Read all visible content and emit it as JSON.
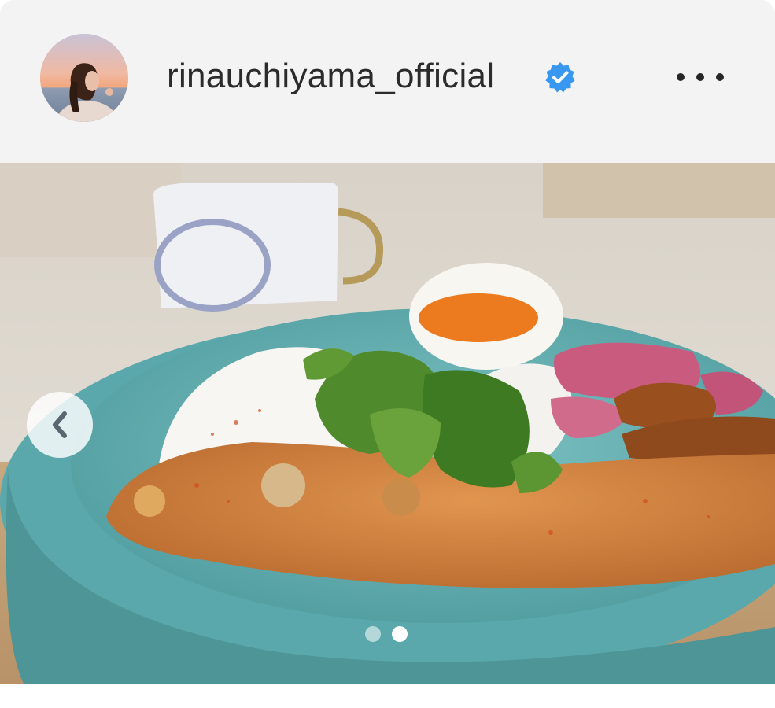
{
  "post": {
    "username": "rinauchiyama_official",
    "verified": true,
    "icons": {
      "avatar": "profile-photo",
      "verified": "verified-badge-icon",
      "more": "more-options-icon",
      "previous": "chevron-left-icon"
    },
    "colors": {
      "verified_blue": "#3897f0",
      "header_bg": "#f3f3f3",
      "bowl": "#5aa8ab",
      "curry": "#c97a3c"
    },
    "carousel": {
      "total_slides": 2,
      "active_slide": 2
    }
  }
}
